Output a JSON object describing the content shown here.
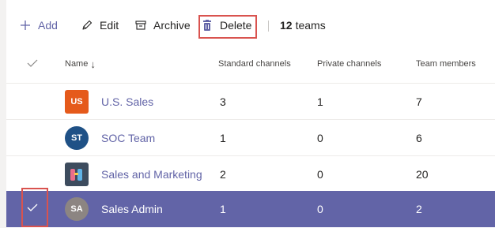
{
  "toolbar": {
    "add_label": "Add",
    "edit_label": "Edit",
    "archive_label": "Archive",
    "delete_label": "Delete",
    "team_count": "12",
    "team_count_label": "teams"
  },
  "table": {
    "columns": {
      "name": "Name",
      "standard_channels": "Standard channels",
      "private_channels": "Private channels",
      "team_members": "Team members"
    },
    "rows": [
      {
        "avatar": "US",
        "name": "U.S. Sales",
        "standard": "3",
        "private": "1",
        "members": "7"
      },
      {
        "avatar": "ST",
        "name": "SOC Team",
        "standard": "1",
        "private": "0",
        "members": "6"
      },
      {
        "avatar": "",
        "name": "Sales and Marketing",
        "standard": "2",
        "private": "0",
        "members": "20"
      },
      {
        "avatar": "SA",
        "name": "Sales Admin",
        "standard": "1",
        "private": "0",
        "members": "2"
      }
    ]
  },
  "colors": {
    "accent": "#6264a7",
    "highlight_box": "#d9534f"
  }
}
